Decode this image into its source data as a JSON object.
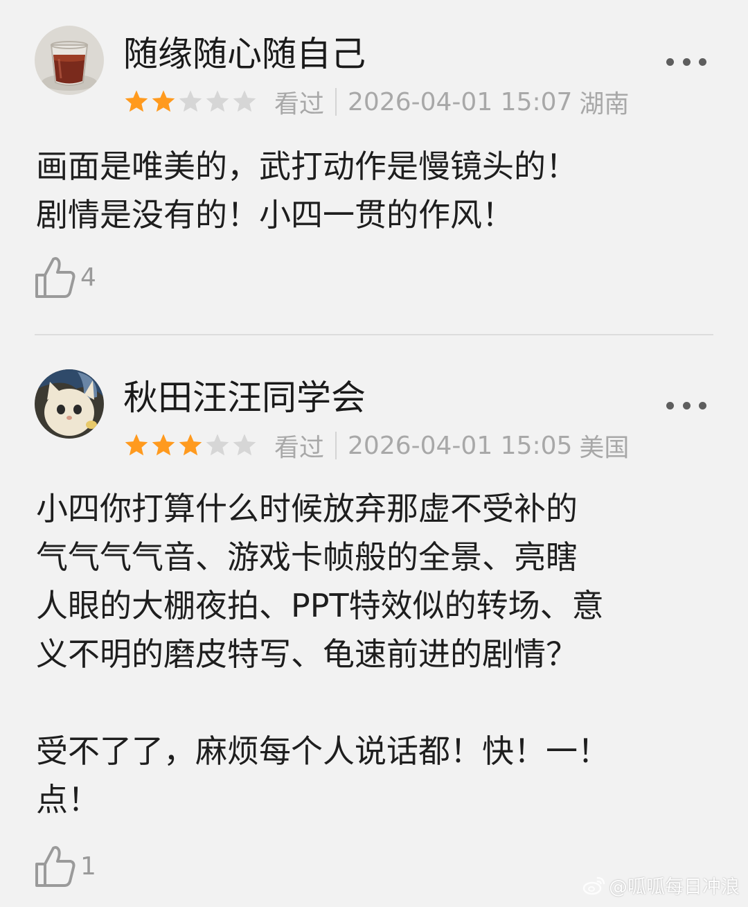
{
  "colors": {
    "background": "#f2f2f2",
    "star_filled": "#ff9a1e",
    "star_empty": "#d6d6d6",
    "meta_text": "#a8a8a8",
    "body_text": "#1e1e1e"
  },
  "reviews": [
    {
      "username": "随缘随心随自己",
      "avatar_icon": "tea-glass-avatar",
      "rating": 2,
      "rating_max": 5,
      "status": "看过",
      "time": "2026-04-01 15:07",
      "location": "湖南",
      "content": "画面是唯美的，武打动作是慢镜头的！\n剧情是没有的！小四一贯的作风！",
      "likes": "4"
    },
    {
      "username": "秋田汪汪同学会",
      "avatar_icon": "cat-avatar",
      "rating": 3,
      "rating_max": 5,
      "status": "看过",
      "time": "2026-04-01 15:05",
      "location": "美国",
      "content": "小四你打算什么时候放弃那虚不受补的\n气气气气音、游戏卡帧般的全景、亮瞎\n人眼的大棚夜拍、PPT特效似的转场、意\n义不明的磨皮特写、龟速前进的剧情？\n\n受不了了，麻烦每个人说话都！快！一！\n点！",
      "likes": "1"
    }
  ],
  "watermark": {
    "icon": "weibo-logo-icon",
    "text": "@呱呱每日冲浪"
  }
}
